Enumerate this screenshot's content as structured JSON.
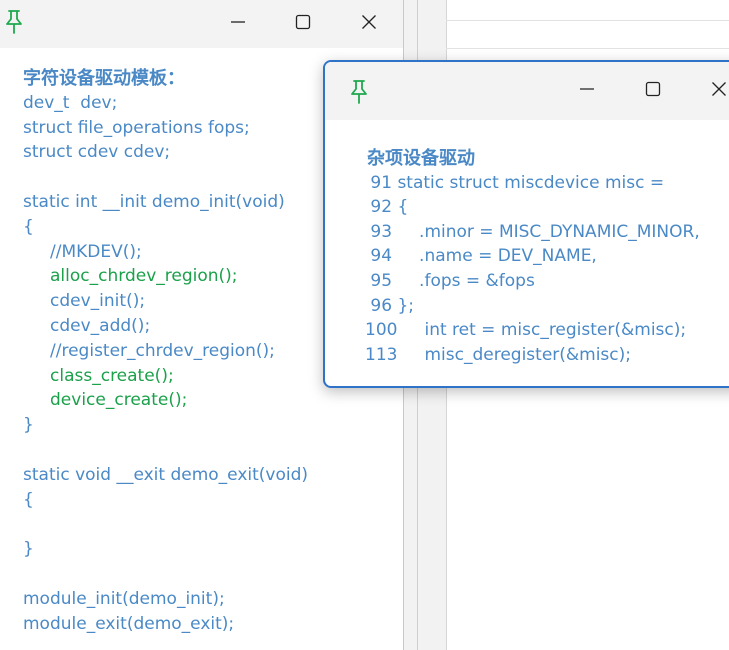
{
  "window1": {
    "title": "字符设备驱动模板：",
    "lines": [
      {
        "text": "dev_t  dev;",
        "color": "blue"
      },
      {
        "text": "struct file_operations fops;",
        "color": "blue"
      },
      {
        "text": "struct cdev cdev;",
        "color": "blue"
      },
      {
        "text": "",
        "color": "blue"
      },
      {
        "text": "static int __init demo_init(void)",
        "color": "blue"
      },
      {
        "text": "{",
        "color": "blue"
      },
      {
        "text": "     //MKDEV();",
        "color": "blue"
      },
      {
        "text": "     alloc_chrdev_region();",
        "color": "green"
      },
      {
        "text": "     cdev_init();",
        "color": "blue"
      },
      {
        "text": "     cdev_add();",
        "color": "blue"
      },
      {
        "text": "     //register_chrdev_region();",
        "color": "blue"
      },
      {
        "text": "     class_create();",
        "color": "green"
      },
      {
        "text": "     device_create();",
        "color": "green"
      },
      {
        "text": "}",
        "color": "blue"
      },
      {
        "text": "",
        "color": "blue"
      },
      {
        "text": "static void __exit demo_exit(void)",
        "color": "blue"
      },
      {
        "text": "{",
        "color": "blue"
      },
      {
        "text": "",
        "color": "blue"
      },
      {
        "text": "}",
        "color": "blue"
      },
      {
        "text": "",
        "color": "blue"
      },
      {
        "text": "module_init(demo_init);",
        "color": "blue"
      },
      {
        "text": "module_exit(demo_exit);",
        "color": "blue"
      }
    ]
  },
  "window2": {
    "title": "杂项设备驱动",
    "lines": [
      {
        "text": " 91 static struct miscdevice misc ="
      },
      {
        "text": " 92 {"
      },
      {
        "text": " 93     .minor = MISC_DYNAMIC_MINOR,"
      },
      {
        "text": " 94     .name = DEV_NAME,"
      },
      {
        "text": " 95     .fops = &fops"
      },
      {
        "text": " 96 };"
      },
      {
        "text": "100     int ret = misc_register(&misc);"
      },
      {
        "text": "113     misc_deregister(&misc);"
      }
    ]
  },
  "icons": {
    "pin": "pin-icon",
    "minimize": "minimize-icon",
    "maximize": "maximize-icon",
    "close": "close-icon"
  },
  "colors": {
    "code_blue": "#4a89c6",
    "code_green": "#1aa14a",
    "pin_green": "#1fa84f",
    "active_border": "#2f73c9"
  }
}
